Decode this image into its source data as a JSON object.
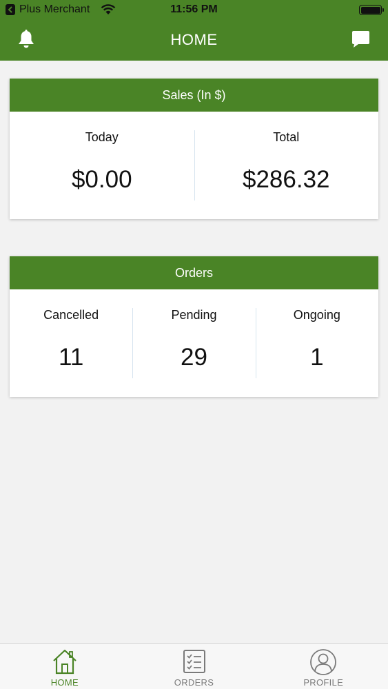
{
  "status_bar": {
    "carrier": "Plus Merchant",
    "time": "11:56 PM"
  },
  "header": {
    "title": "HOME",
    "left_icon": "bell-icon",
    "right_icon": "chat-icon"
  },
  "sales_card": {
    "title": "Sales (In $)",
    "columns": [
      {
        "label": "Today",
        "value": "$0.00"
      },
      {
        "label": "Total",
        "value": "$286.32"
      }
    ]
  },
  "orders_card": {
    "title": "Orders",
    "columns": [
      {
        "label": "Cancelled",
        "value": "11"
      },
      {
        "label": "Pending",
        "value": "29"
      },
      {
        "label": "Ongoing",
        "value": "1"
      }
    ]
  },
  "tabbar": {
    "tabs": [
      {
        "label": "HOME",
        "icon": "home-icon",
        "active": true
      },
      {
        "label": "ORDERS",
        "icon": "checklist-icon",
        "active": false
      },
      {
        "label": "PROFILE",
        "icon": "profile-icon",
        "active": false
      }
    ]
  },
  "colors": {
    "brand_green": "#4a8426",
    "inactive_gray": "#7a7a7a"
  }
}
